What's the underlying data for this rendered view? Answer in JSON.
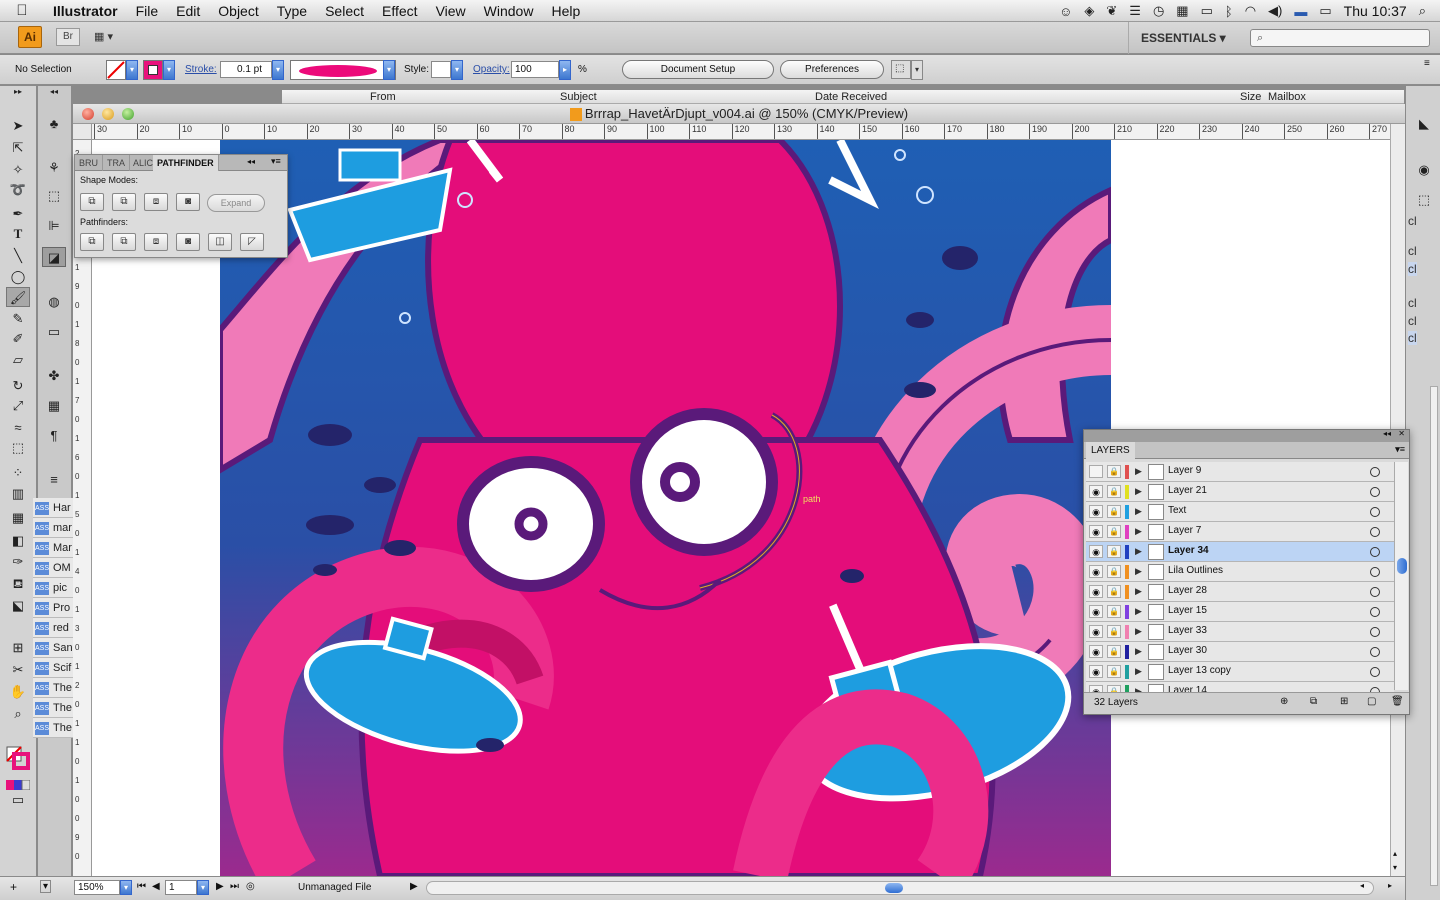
{
  "menubar": {
    "app_name": "Illustrator",
    "items": [
      "File",
      "Edit",
      "Object",
      "Type",
      "Select",
      "Effect",
      "View",
      "Window",
      "Help"
    ],
    "clock": "Thu 10:37"
  },
  "appbar": {
    "app_badge": "Ai",
    "bridge_badge": "Br",
    "workspace": "ESSENTIALS ▾"
  },
  "control": {
    "selection": "No Selection",
    "stroke_label": "Stroke:",
    "stroke_weight": "0.1 pt",
    "style_label": "Style:",
    "opacity_label": "Opacity:",
    "opacity_value": "100",
    "opacity_unit": "%",
    "document_setup": "Document Setup",
    "preferences": "Preferences",
    "fill_color": "#ffffff",
    "stroke_color": "#e8127c"
  },
  "mail_header": {
    "from": "From",
    "subject": "Subject",
    "date_received": "Date Received",
    "size": "Size",
    "mailbox": "Mailbox"
  },
  "document": {
    "title": "Brrrap_HavetÄrDjupt_v004.ai @ 150% (CMYK/Preview)"
  },
  "ruler": {
    "h_labels": [
      "30",
      "20",
      "10",
      "0",
      "10",
      "20",
      "30",
      "40",
      "50",
      "60",
      "70",
      "80",
      "90",
      "100",
      "110",
      "120",
      "130",
      "140",
      "150",
      "160",
      "170",
      "180",
      "190",
      "200",
      "210",
      "220",
      "230",
      "240",
      "250",
      "260",
      "270"
    ],
    "v_labels": [
      "2",
      "2",
      "0",
      "2",
      "1",
      "0",
      "1",
      "9",
      "0",
      "1",
      "8",
      "0",
      "1",
      "7",
      "0",
      "1",
      "6",
      "0",
      "1",
      "5",
      "0",
      "1",
      "4",
      "0",
      "1",
      "3",
      "0",
      "1",
      "2",
      "0",
      "1",
      "1",
      "0",
      "1",
      "0",
      "0",
      "9",
      "0"
    ]
  },
  "pathfinder": {
    "tabs": [
      "BRU",
      "TRA",
      "ALIC",
      "PATHFINDER"
    ],
    "shape_modes_label": "Shape Modes:",
    "pathfinders_label": "Pathfinders:",
    "expand_label": "Expand"
  },
  "canvas": {
    "path_hint": "path"
  },
  "side_panel_items": [
    "Har",
    "mar",
    "Mar",
    "OM",
    "pic",
    "Pro",
    "red",
    "San",
    "Scif",
    "The",
    "The",
    "The"
  ],
  "right_dock_labels": [
    "cl",
    "cl",
    "cl",
    "cl",
    "cl",
    "cl"
  ],
  "layers": {
    "title": "LAYERS",
    "count": "32 Layers",
    "rows": [
      {
        "name": "Layer 9",
        "color": "#e05050",
        "selected": false,
        "visible": false
      },
      {
        "name": "Layer 21",
        "color": "#e0e020",
        "selected": false,
        "visible": true
      },
      {
        "name": "Text",
        "color": "#20a0e0",
        "selected": false,
        "visible": true
      },
      {
        "name": "Layer 7",
        "color": "#e040c0",
        "selected": false,
        "visible": true
      },
      {
        "name": "Layer 34",
        "color": "#2040c0",
        "selected": true,
        "visible": true
      },
      {
        "name": "Lila Outlines",
        "color": "#f09020",
        "selected": false,
        "visible": true
      },
      {
        "name": "Layer 28",
        "color": "#f09020",
        "selected": false,
        "visible": true
      },
      {
        "name": "Layer 15",
        "color": "#8040e0",
        "selected": false,
        "visible": true
      },
      {
        "name": "Layer 33",
        "color": "#f080b0",
        "selected": false,
        "visible": true
      },
      {
        "name": "Layer 30",
        "color": "#2020a0",
        "selected": false,
        "visible": true
      },
      {
        "name": "Layer 13 copy",
        "color": "#20a0a0",
        "selected": false,
        "visible": true
      },
      {
        "name": "Layer 14",
        "color": "#20a060",
        "selected": false,
        "visible": true
      }
    ]
  },
  "status": {
    "zoom": "150%",
    "artboard": "1",
    "doc_status": "Unmanaged File"
  }
}
